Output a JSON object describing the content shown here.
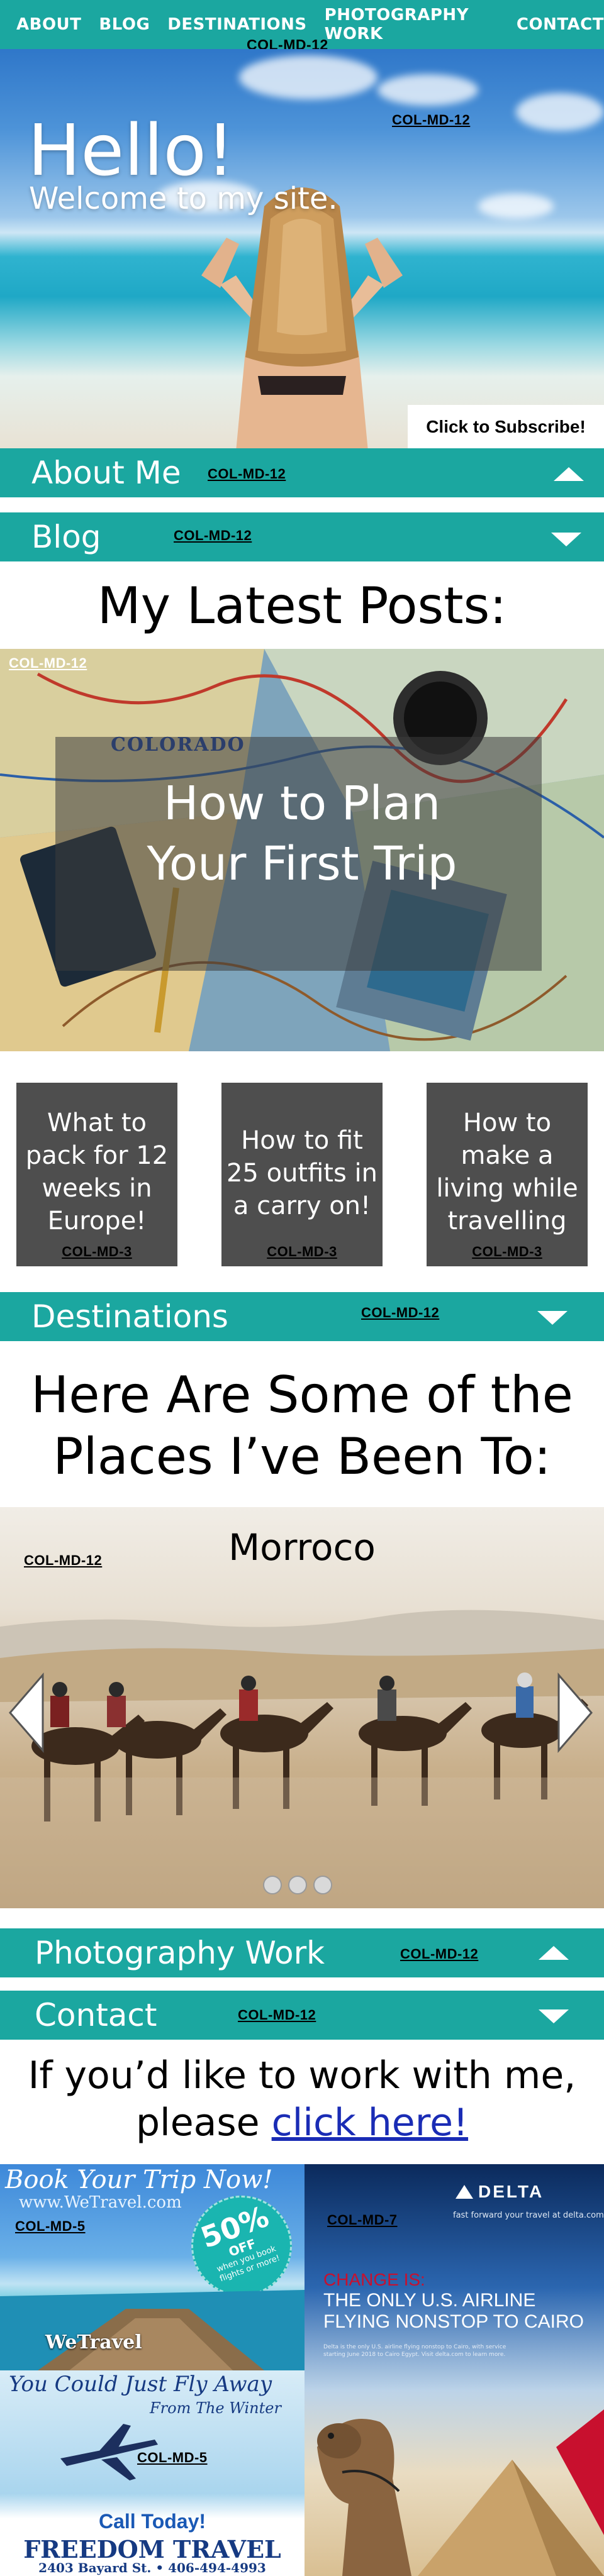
{
  "nav": {
    "items": [
      "ABOUT",
      "BLOG",
      "DESTINATIONS",
      "PHOTOGRAPHY WORK",
      "CONTACT"
    ]
  },
  "col_labels": {
    "nav": "COL-MD-12",
    "hero": "COL-MD-12",
    "about": "COL-MD-12",
    "blog": "COL-MD-12",
    "feature": "COL-MD-12",
    "card": "COL-MD-3",
    "destinations": "COL-MD-12",
    "carousel": "COL-MD-12",
    "photography": "COL-MD-12",
    "contact": "COL-MD-12",
    "ad1": "COL-MD-5",
    "ad2": "COL-MD-5",
    "ad3": "COL-MD-7"
  },
  "hero": {
    "title": "Hello!",
    "subtitle": "Welcome to my site.",
    "subscribe": "Click to Subscribe!"
  },
  "sections": {
    "about": "About Me",
    "blog": "Blog",
    "destinations": "Destinations",
    "photography": "Photography Work",
    "contact": "Contact"
  },
  "blog": {
    "heading": "My Latest Posts:",
    "feature_line1": "How to Plan",
    "feature_line2": "Your First Trip",
    "map_label": "COLORADO",
    "posts": [
      {
        "l1": "What to",
        "l2": "pack for 12",
        "l3": "weeks in",
        "l4": "Europe!"
      },
      {
        "l1": "How to fit",
        "l2": "25 outfits in",
        "l3": "a carry on!",
        "l4": ""
      },
      {
        "l1": "How to",
        "l2": "make a",
        "l3": "living while",
        "l4": "travelling"
      }
    ]
  },
  "destinations": {
    "heading_line1": "Here Are Some of the",
    "heading_line2": "Places I’ve Been To:",
    "slide_title": "Morroco",
    "slide_count": 3
  },
  "contact": {
    "line1": "If you’d like to work with me,",
    "line2_prefix": "please ",
    "link": "click here!"
  },
  "ads": {
    "a1": {
      "title": "Book Your Trip Now!",
      "url": "www.WeTravel.com",
      "badge_pct": "50%",
      "badge_off": "OFF",
      "badge_text": "when you book flights or more!",
      "brand": "WeTravel"
    },
    "a2": {
      "title": "You Could Just Fly Away",
      "subtitle": "From The Winter",
      "call": "Call Today!",
      "brand": "FREEDOM TRAVEL",
      "address": "2403 Bayard St. • 406-494-4993"
    },
    "a3": {
      "brand": "DELTA",
      "tagline": "fast forward your travel at delta.com",
      "headline1": "CHANGE IS:",
      "headline2": "THE ONLY U.S. AIRLINE",
      "headline3": "FLYING NONSTOP TO CAIRO",
      "fine_print": "Delta is the only U.S. airline flying nonstop to Cairo, with service starting June 2018 to Cairo Egypt. Visit delta.com to learn more."
    }
  },
  "colors": {
    "teal": "#1ba7a0",
    "card_gray": "#4e4e4e",
    "link_blue": "#1a2cb5",
    "delta_red": "#c8102e",
    "delta_navy": "#0b2a5c"
  }
}
